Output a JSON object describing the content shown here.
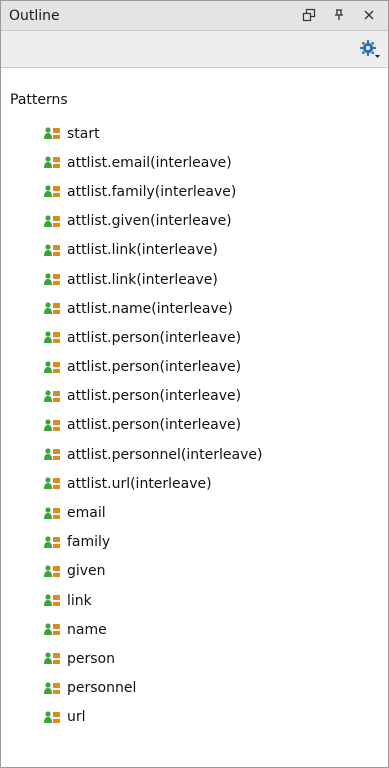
{
  "window": {
    "title": "Outline",
    "restore_icon": "restore-icon",
    "pin_icon": "pin-icon",
    "close_icon": "close-icon"
  },
  "toolbar": {
    "settings_icon": "gear-dropdown-icon"
  },
  "tree": {
    "root_label": "Patterns",
    "items": [
      {
        "label": "start",
        "icon": "pattern-icon"
      },
      {
        "label": "attlist.email(interleave)",
        "icon": "pattern-icon"
      },
      {
        "label": "attlist.family(interleave)",
        "icon": "pattern-icon"
      },
      {
        "label": "attlist.given(interleave)",
        "icon": "pattern-icon"
      },
      {
        "label": "attlist.link(interleave)",
        "icon": "pattern-icon"
      },
      {
        "label": "attlist.link(interleave)",
        "icon": "pattern-icon"
      },
      {
        "label": "attlist.name(interleave)",
        "icon": "pattern-icon"
      },
      {
        "label": "attlist.person(interleave)",
        "icon": "pattern-icon"
      },
      {
        "label": "attlist.person(interleave)",
        "icon": "pattern-icon"
      },
      {
        "label": "attlist.person(interleave)",
        "icon": "pattern-icon"
      },
      {
        "label": "attlist.person(interleave)",
        "icon": "pattern-icon"
      },
      {
        "label": "attlist.personnel(interleave)",
        "icon": "pattern-icon"
      },
      {
        "label": "attlist.url(interleave)",
        "icon": "pattern-icon"
      },
      {
        "label": "email",
        "icon": "pattern-icon"
      },
      {
        "label": "family",
        "icon": "pattern-icon"
      },
      {
        "label": "given",
        "icon": "pattern-icon"
      },
      {
        "label": "link",
        "icon": "pattern-icon"
      },
      {
        "label": "name",
        "icon": "pattern-icon"
      },
      {
        "label": "person",
        "icon": "pattern-icon"
      },
      {
        "label": "personnel",
        "icon": "pattern-icon"
      },
      {
        "label": "url",
        "icon": "pattern-icon"
      }
    ]
  },
  "colors": {
    "icon_green": "#3aa53a",
    "icon_orange": "#e08a1e",
    "gear_blue": "#2f6fb8"
  }
}
